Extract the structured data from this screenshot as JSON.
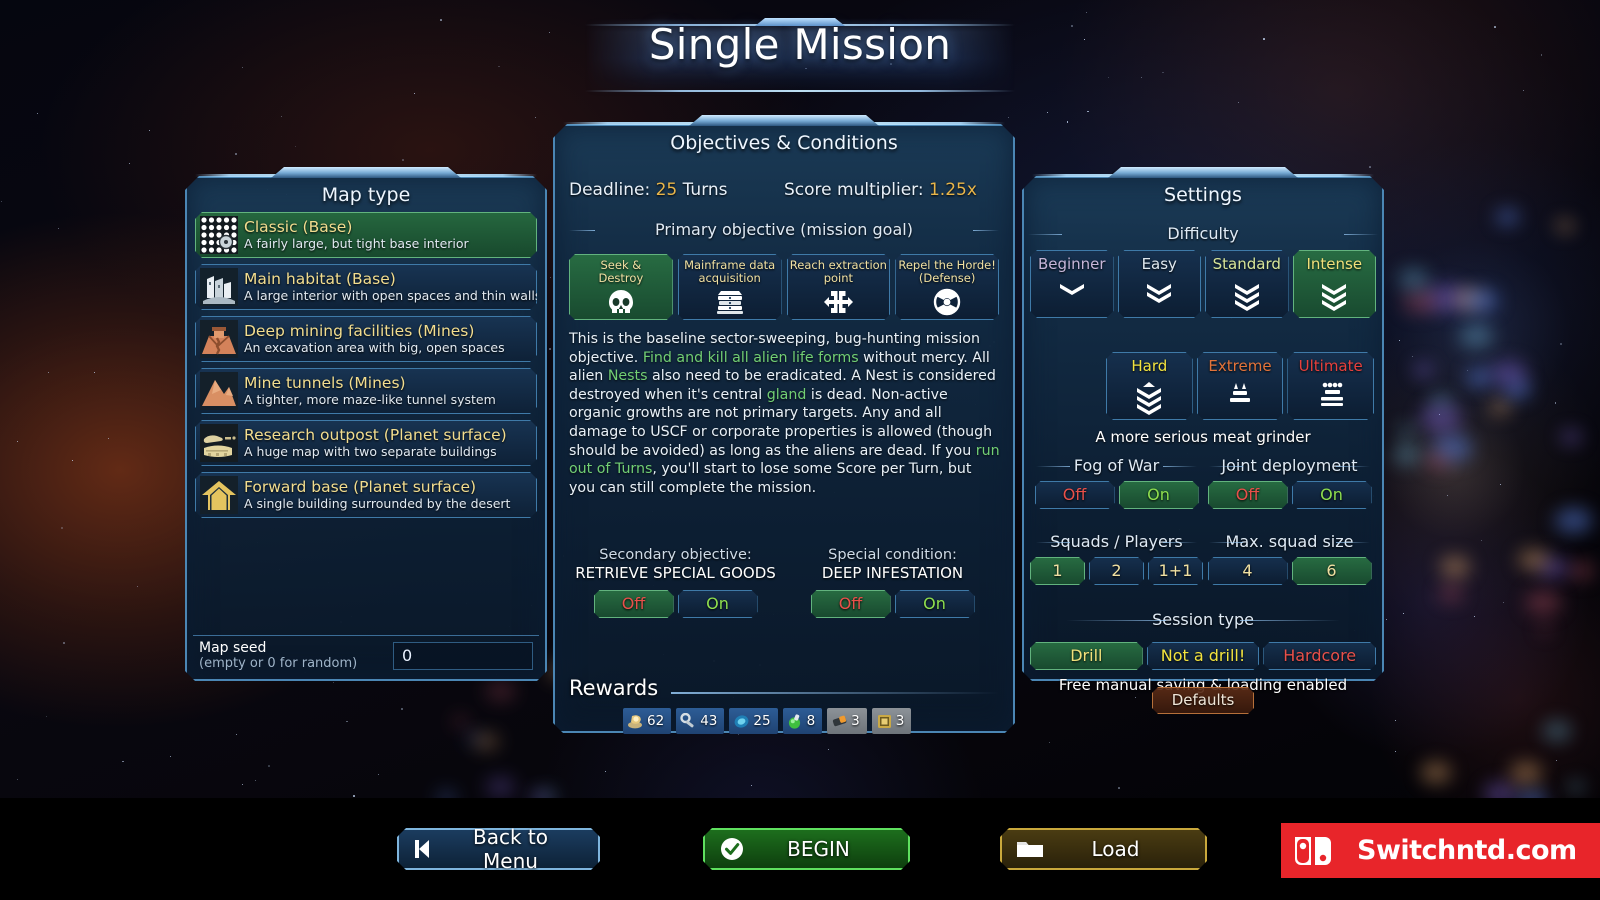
{
  "page_title": "Single Mission",
  "background": {
    "style": "space-nebula",
    "colors": [
      "#05060f",
      "#aa4619",
      "#1e3778"
    ]
  },
  "map_panel": {
    "title": "Map type",
    "items": [
      {
        "name": "Classic (Base)",
        "desc": "A fairly large, but tight base interior",
        "icon": "grid-dots-icon",
        "selected": true
      },
      {
        "name": "Main habitat (Base)",
        "desc": "A large interior with open spaces and thin walls",
        "icon": "buildings-icon",
        "selected": false
      },
      {
        "name": "Deep mining facilities (Mines)",
        "desc": "An excavation area with big, open spaces",
        "icon": "mine-shaft-icon",
        "selected": false
      },
      {
        "name": "Mine tunnels (Mines)",
        "desc": "A tighter, more maze-like tunnel system",
        "icon": "mountain-icon",
        "selected": false
      },
      {
        "name": "Research outpost (Planet surface)",
        "desc": "A huge map with two separate buildings",
        "icon": "outpost-icon",
        "selected": false
      },
      {
        "name": "Forward base (Planet surface)",
        "desc": "A single building surrounded by the desert",
        "icon": "house-icon",
        "selected": false
      }
    ],
    "seed": {
      "label": "Map seed",
      "hint": "(empty or 0 for random)",
      "value": "0"
    }
  },
  "objectives_panel": {
    "title": "Objectives & Conditions",
    "deadline_label": "Deadline:",
    "deadline_value": "25",
    "deadline_unit": "Turns",
    "multiplier_label": "Score multiplier:",
    "multiplier_value": "1.25x",
    "primary_heading": "Primary objective (mission goal)",
    "primary_options": [
      {
        "label": "Seek &\nDestroy",
        "line1": "Seek &",
        "line2": "Destroy",
        "icon": "skull-icon",
        "selected": true
      },
      {
        "label": "Mainframe data acquisition",
        "line1": "Mainframe data",
        "line2": "acquisition",
        "icon": "server-stack-icon",
        "selected": false
      },
      {
        "label": "Reach extraction point",
        "line1": "Reach extraction",
        "line2": "point",
        "icon": "extraction-arrows-icon",
        "selected": false
      },
      {
        "label": "Repel the Horde! (Defense)",
        "line1": "Repel the Horde!",
        "line2": "(Defense)",
        "icon": "biohazard-icon",
        "selected": false
      }
    ],
    "description_parts": [
      {
        "t": "This is the baseline sector-sweeping, bug-hunting mission objective. ",
        "hl": false
      },
      {
        "t": "Find and kill all alien life forms",
        "hl": true
      },
      {
        "t": " without mercy. All alien ",
        "hl": false
      },
      {
        "t": "Nests",
        "hl": true
      },
      {
        "t": " also need to be eradicated. A Nest is considered destroyed when it's central ",
        "hl": false
      },
      {
        "t": "gland",
        "hl": true
      },
      {
        "t": " is dead. Non-active organic growths are not primary targets. Any and all damage to USCF or corporate properties is allowed (though should be avoided) as long as the aliens are dead. If you ",
        "hl": false
      },
      {
        "t": "run out of Turns",
        "hl": true
      },
      {
        "t": ", you'll start to lose some Score per Turn, but you can still complete the mission.",
        "hl": false
      }
    ],
    "secondary": {
      "caption": "Secondary objective:",
      "name": "RETRIEVE SPECIAL GOODS",
      "options": [
        {
          "label": "Off",
          "selected": true,
          "color": "off"
        },
        {
          "label": "On",
          "selected": false,
          "color": "on"
        }
      ]
    },
    "special": {
      "caption": "Special condition:",
      "name": "DEEP INFESTATION",
      "options": [
        {
          "label": "Off",
          "selected": true,
          "color": "off"
        },
        {
          "label": "On",
          "selected": false,
          "color": "on"
        }
      ]
    },
    "rewards_title": "Rewards",
    "rewards": [
      {
        "icon": "gold-coin-icon",
        "value": "62",
        "dim": false
      },
      {
        "icon": "wrench-icon",
        "value": "43",
        "dim": false
      },
      {
        "icon": "blue-lens-icon",
        "value": "25",
        "dim": false
      },
      {
        "icon": "green-canister-icon",
        "value": "8",
        "dim": false
      },
      {
        "icon": "orange-cartridge-icon",
        "value": "3",
        "dim": true
      },
      {
        "icon": "gold-crate-icon",
        "value": "3",
        "dim": true
      }
    ]
  },
  "settings_panel": {
    "title": "Settings",
    "difficulty_label": "Difficulty",
    "difficulty_row1": [
      {
        "label": "Beginner",
        "color": "#c6b6d8",
        "icon": "chevron-1-icon",
        "chevrons": 1,
        "bar": false,
        "selected": false
      },
      {
        "label": "Easy",
        "color": "#dfe8ef",
        "icon": "chevron-2-icon",
        "chevrons": 2,
        "bar": false,
        "selected": false
      },
      {
        "label": "Standard",
        "color": "#d8e69a",
        "icon": "chevron-3-icon",
        "chevrons": 3,
        "bar": false,
        "selected": false
      },
      {
        "label": "Intense",
        "color": "#f0e07a",
        "icon": "chevron-3-icon",
        "chevrons": 3,
        "bar": false,
        "selected": true
      }
    ],
    "difficulty_row2": [
      {
        "label": "Hard",
        "color": "#f2e33f",
        "icon": "chevron-3-bar-icon",
        "chevrons": 3,
        "bar": true,
        "selected": false
      },
      {
        "label": "Extreme",
        "color": "#e2733a",
        "icon": "extreme-rank-icon",
        "chevrons": 0,
        "bar": true,
        "selected": false
      },
      {
        "label": "Ultimate",
        "color": "#e8403c",
        "icon": "ultimate-rank-icon",
        "chevrons": 0,
        "bar": true,
        "selected": false
      }
    ],
    "difficulty_desc": "A more serious meat grinder",
    "fog_of_war": {
      "label": "Fog of War",
      "options": [
        {
          "label": "Off",
          "color": "off",
          "selected": false
        },
        {
          "label": "On",
          "color": "on",
          "selected": true
        }
      ]
    },
    "joint_deployment": {
      "label": "Joint deployment",
      "options": [
        {
          "label": "Off",
          "color": "off",
          "selected": true
        },
        {
          "label": "On",
          "color": "on",
          "selected": false
        }
      ]
    },
    "squads_players": {
      "label": "Squads / Players",
      "options": [
        {
          "label": "1",
          "selected": true
        },
        {
          "label": "2",
          "selected": false
        },
        {
          "label": "1+1",
          "selected": false
        }
      ]
    },
    "max_squad_size": {
      "label": "Max. squad size",
      "options": [
        {
          "label": "4",
          "selected": false
        },
        {
          "label": "6",
          "selected": true
        }
      ]
    },
    "session_type": {
      "label": "Session type",
      "options": [
        {
          "label": "Drill",
          "color": "#f0e07a",
          "selected": true
        },
        {
          "label": "Not a drill!",
          "color": "#f2e33f",
          "selected": false
        },
        {
          "label": "Hardcore",
          "color": "#e8504a",
          "selected": false
        }
      ],
      "note": "Free manual saving & loading enabled"
    },
    "defaults_label": "Defaults"
  },
  "bottom_bar": {
    "back": {
      "label": "Back to Menu",
      "icon": "rewind-left-icon"
    },
    "begin": {
      "label": "BEGIN",
      "icon": "check-circle-icon"
    },
    "load": {
      "label": "Load",
      "icon": "folder-icon"
    }
  },
  "watermark": {
    "text": "Switchntd.com",
    "icon": "nintendo-switch-icon",
    "bg": "#e8252a"
  }
}
